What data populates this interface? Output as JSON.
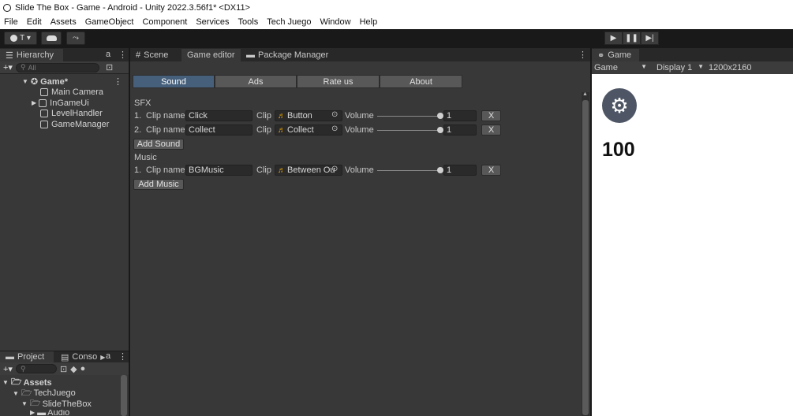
{
  "window": {
    "title": "Slide The Box - Game - Android - Unity 2022.3.56f1* <DX11>"
  },
  "menu": [
    "File",
    "Edit",
    "Assets",
    "GameObject",
    "Component",
    "Services",
    "Tools",
    "Tech Juego",
    "Window",
    "Help"
  ],
  "toolbar": {
    "account_label": "T ▾",
    "play_icon": "play-icon",
    "pause_icon": "pause-icon",
    "step_icon": "step-icon"
  },
  "hierarchy": {
    "tab_label": "Hierarchy",
    "search_placeholder": "All",
    "scene_name": "Game*",
    "items": [
      "Main Camera",
      "InGameUi",
      "LevelHandler",
      "GameManager"
    ]
  },
  "project": {
    "tabs": [
      "Project",
      "Conso"
    ],
    "tree": [
      "Assets",
      "TechJuego",
      "SlideTheBox",
      "Audio"
    ]
  },
  "editor": {
    "tabs": [
      "Scene",
      "Game editor",
      "Package Manager"
    ],
    "subtabs": [
      "Sound",
      "Ads",
      "Rate us",
      "About"
    ],
    "sfx_header": "SFX",
    "music_header": "Music",
    "clip_name_label": "Clip name",
    "clip_label": "Clip",
    "volume_label": "Volume",
    "remove_label": "X",
    "sfx_rows": [
      {
        "index": "1.",
        "name": "Click",
        "clip": "Button",
        "volume": "1",
        "slider": 1.0
      },
      {
        "index": "2.",
        "name": "Collect",
        "clip": "Collect",
        "volume": "1",
        "slider": 1.0
      }
    ],
    "music_rows": [
      {
        "index": "1.",
        "name": "BGMusic",
        "clip": "Between Ou",
        "volume": "1",
        "slider": 1.0
      }
    ],
    "add_sound_label": "Add Sound",
    "add_music_label": "Add Music"
  },
  "game_view": {
    "tab_label": "Game",
    "mode": "Game",
    "display": "Display 1",
    "resolution": "1200x2160",
    "score": "100"
  },
  "colors": {
    "accent_tab": "#46607c",
    "audio_clip_icon": "#e9a400"
  }
}
